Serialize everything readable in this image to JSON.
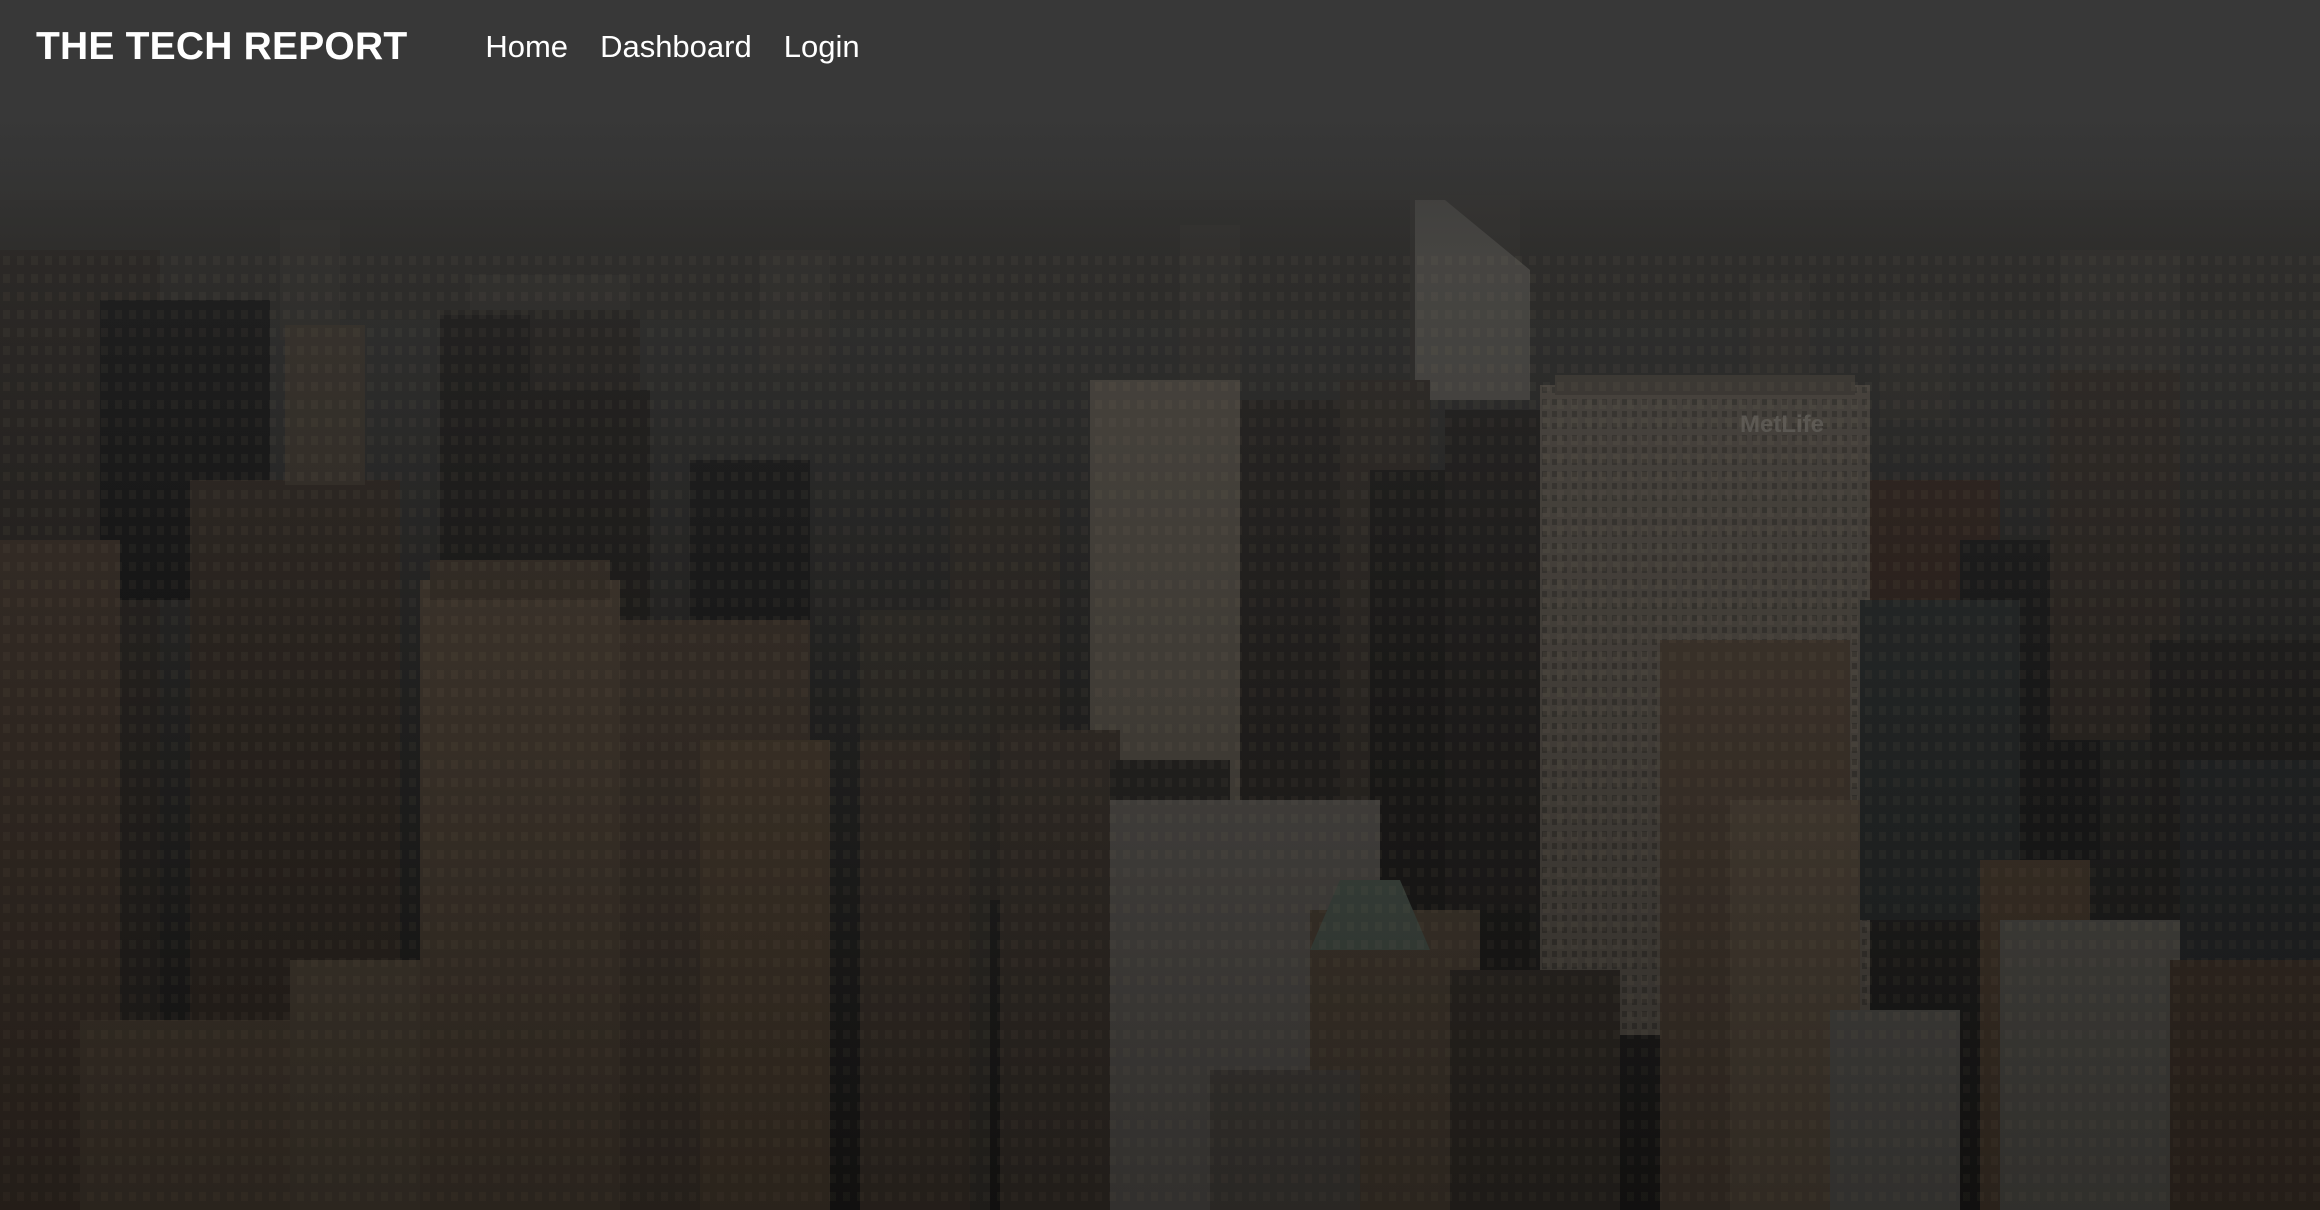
{
  "navbar": {
    "brand": "THE TECH REPORT",
    "links": [
      {
        "label": "Home"
      },
      {
        "label": "Dashboard"
      },
      {
        "label": "Login"
      }
    ]
  },
  "hero": {
    "image": "city-skyline-background",
    "building_sign": "MetLife"
  },
  "colors": {
    "navbar_background": "#383838",
    "text": "#ffffff"
  }
}
